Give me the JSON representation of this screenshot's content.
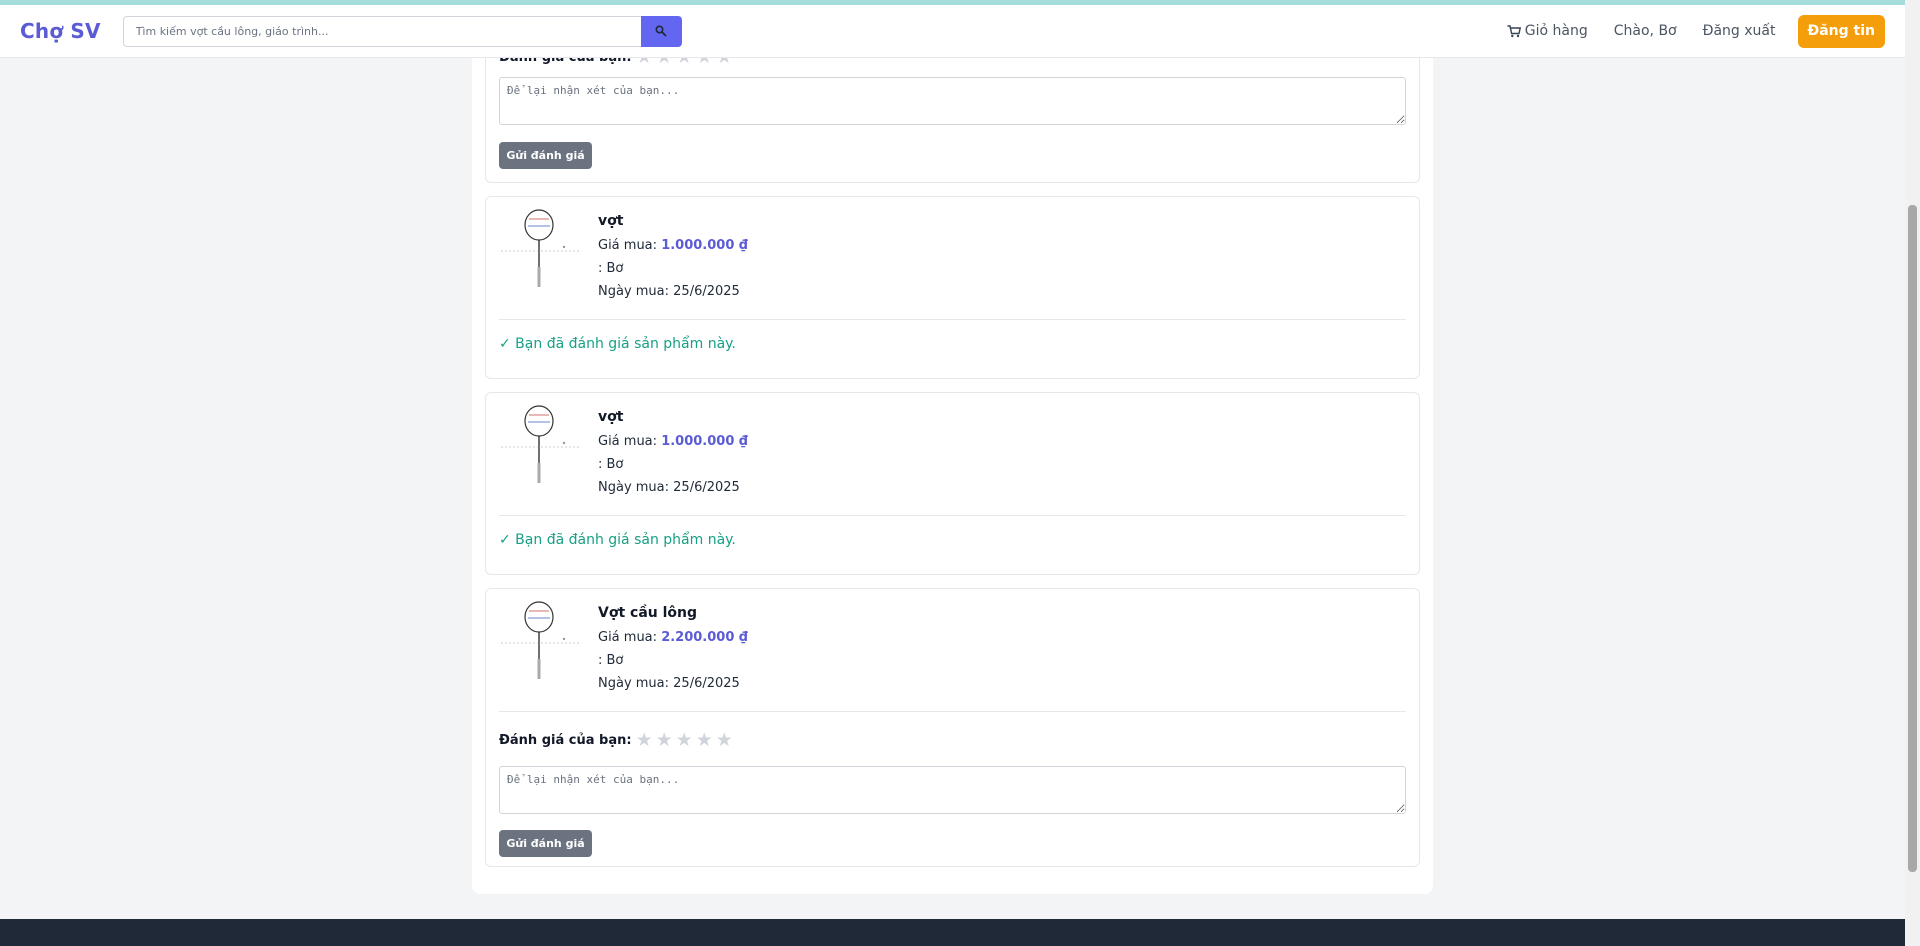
{
  "nav": {
    "logo": "Chợ SV",
    "search_placeholder": "Tìm kiếm vợt cầu lông, giáo trình...",
    "cart_label": "Giỏ hàng",
    "greeting": "Chào, Bơ",
    "logout_label": "Đăng xuất",
    "post_label": "Đăng tin"
  },
  "review_form": {
    "rating_label": "Đánh giá của bạn:",
    "comment_placeholder": "Để lại nhận xét của bạn...",
    "submit_label": "Gửi đánh giá",
    "stars": [
      "★",
      "★",
      "★",
      "★",
      "★"
    ]
  },
  "orders": [
    {
      "name": "vợt",
      "price_label": "Giá mua:",
      "price": "1.000.000 ₫",
      "seller": ": Bơ",
      "date": "Ngày mua: 25/6/2025",
      "reviewed": true,
      "reviewed_text": "✓ Bạn đã đánh giá sản phẩm này."
    },
    {
      "name": "vợt",
      "price_label": "Giá mua:",
      "price": "1.000.000 ₫",
      "seller": ": Bơ",
      "date": "Ngày mua: 25/6/2025",
      "reviewed": true,
      "reviewed_text": "✓ Bạn đã đánh giá sản phẩm này."
    },
    {
      "name": "Vợt cầu lông",
      "price_label": "Giá mua:",
      "price": "2.200.000 ₫",
      "seller": ": Bơ",
      "date": "Ngày mua: 25/6/2025",
      "reviewed": false
    }
  ],
  "colors": {
    "accent": "#5b5bd6",
    "post_button": "#f59e0b",
    "reviewed": "#16a085",
    "footer": "#1f2937"
  }
}
